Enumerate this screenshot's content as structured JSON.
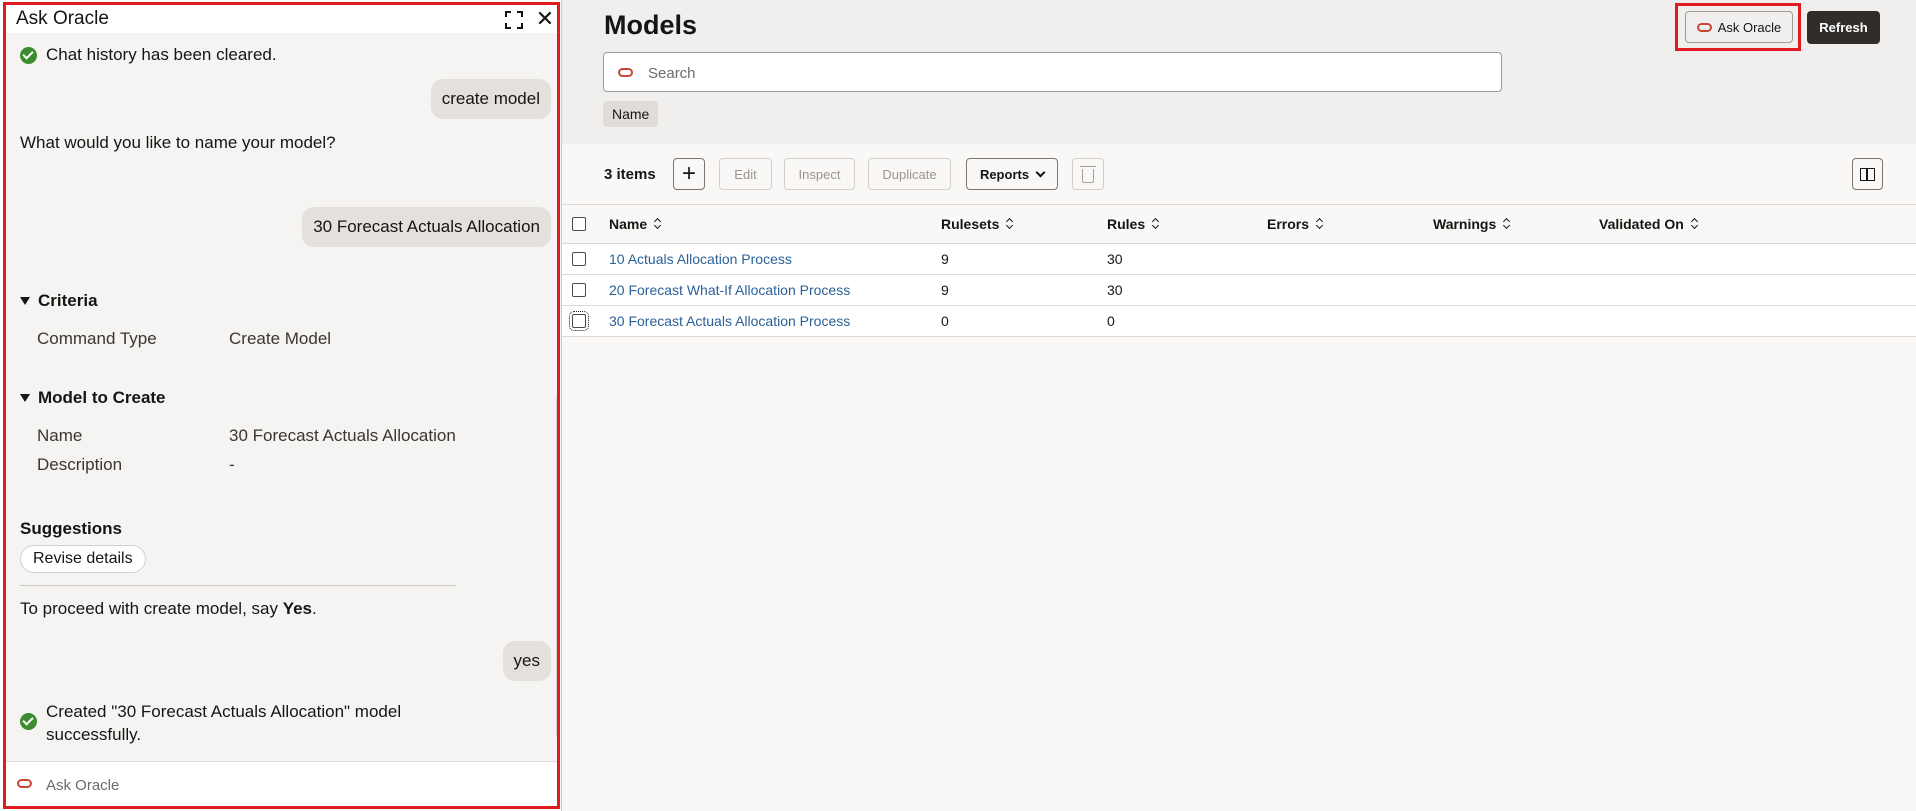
{
  "chat": {
    "title": "Ask Oracle",
    "cleared_msg": "Chat history has been cleared.",
    "user_msg_1": "create model",
    "bot_question": "What would you like to name your model?",
    "user_msg_2": "30 Forecast Actuals Allocation",
    "criteria": {
      "heading": "Criteria",
      "label": "Command Type",
      "value": "Create Model"
    },
    "model_to_create": {
      "heading": "Model to Create",
      "name_label": "Name",
      "name_value": "30 Forecast Actuals Allocation",
      "desc_label": "Description",
      "desc_value": "-"
    },
    "suggestions_title": "Suggestions",
    "suggestion_chip": "Revise details",
    "proceed_prefix": "To proceed with create model, say ",
    "proceed_keyword": "Yes",
    "proceed_suffix": ".",
    "user_msg_3": "yes",
    "created_msg": "Created \"30 Forecast Actuals Allocation\" model successfully.",
    "input_placeholder": "Ask Oracle"
  },
  "main": {
    "title": "Models",
    "search_placeholder": "Search",
    "filter_chip": "Name",
    "ask_oracle_label": "Ask Oracle",
    "refresh_label": "Refresh",
    "items_count": "3 items",
    "toolbar": {
      "add": "+",
      "edit": "Edit",
      "inspect": "Inspect",
      "duplicate": "Duplicate",
      "reports": "Reports"
    },
    "columns": [
      "Name",
      "Rulesets",
      "Rules",
      "Errors",
      "Warnings",
      "Validated On"
    ],
    "rows": [
      {
        "name": "10 Actuals Allocation Process",
        "rulesets": "9",
        "rules": "30",
        "errors": "",
        "warnings": "",
        "validated_on": ""
      },
      {
        "name": "20 Forecast What-If Allocation Process",
        "rulesets": "9",
        "rules": "30",
        "errors": "",
        "warnings": "",
        "validated_on": ""
      },
      {
        "name": "30 Forecast Actuals Allocation Process",
        "rulesets": "0",
        "rules": "0",
        "errors": "",
        "warnings": "",
        "validated_on": ""
      }
    ]
  },
  "colors": {
    "highlight": "#e01b22",
    "oracle_brand": "#c74634",
    "link": "#2b6198",
    "success": "#3b8d2f",
    "primary_button": "#312d2a"
  }
}
